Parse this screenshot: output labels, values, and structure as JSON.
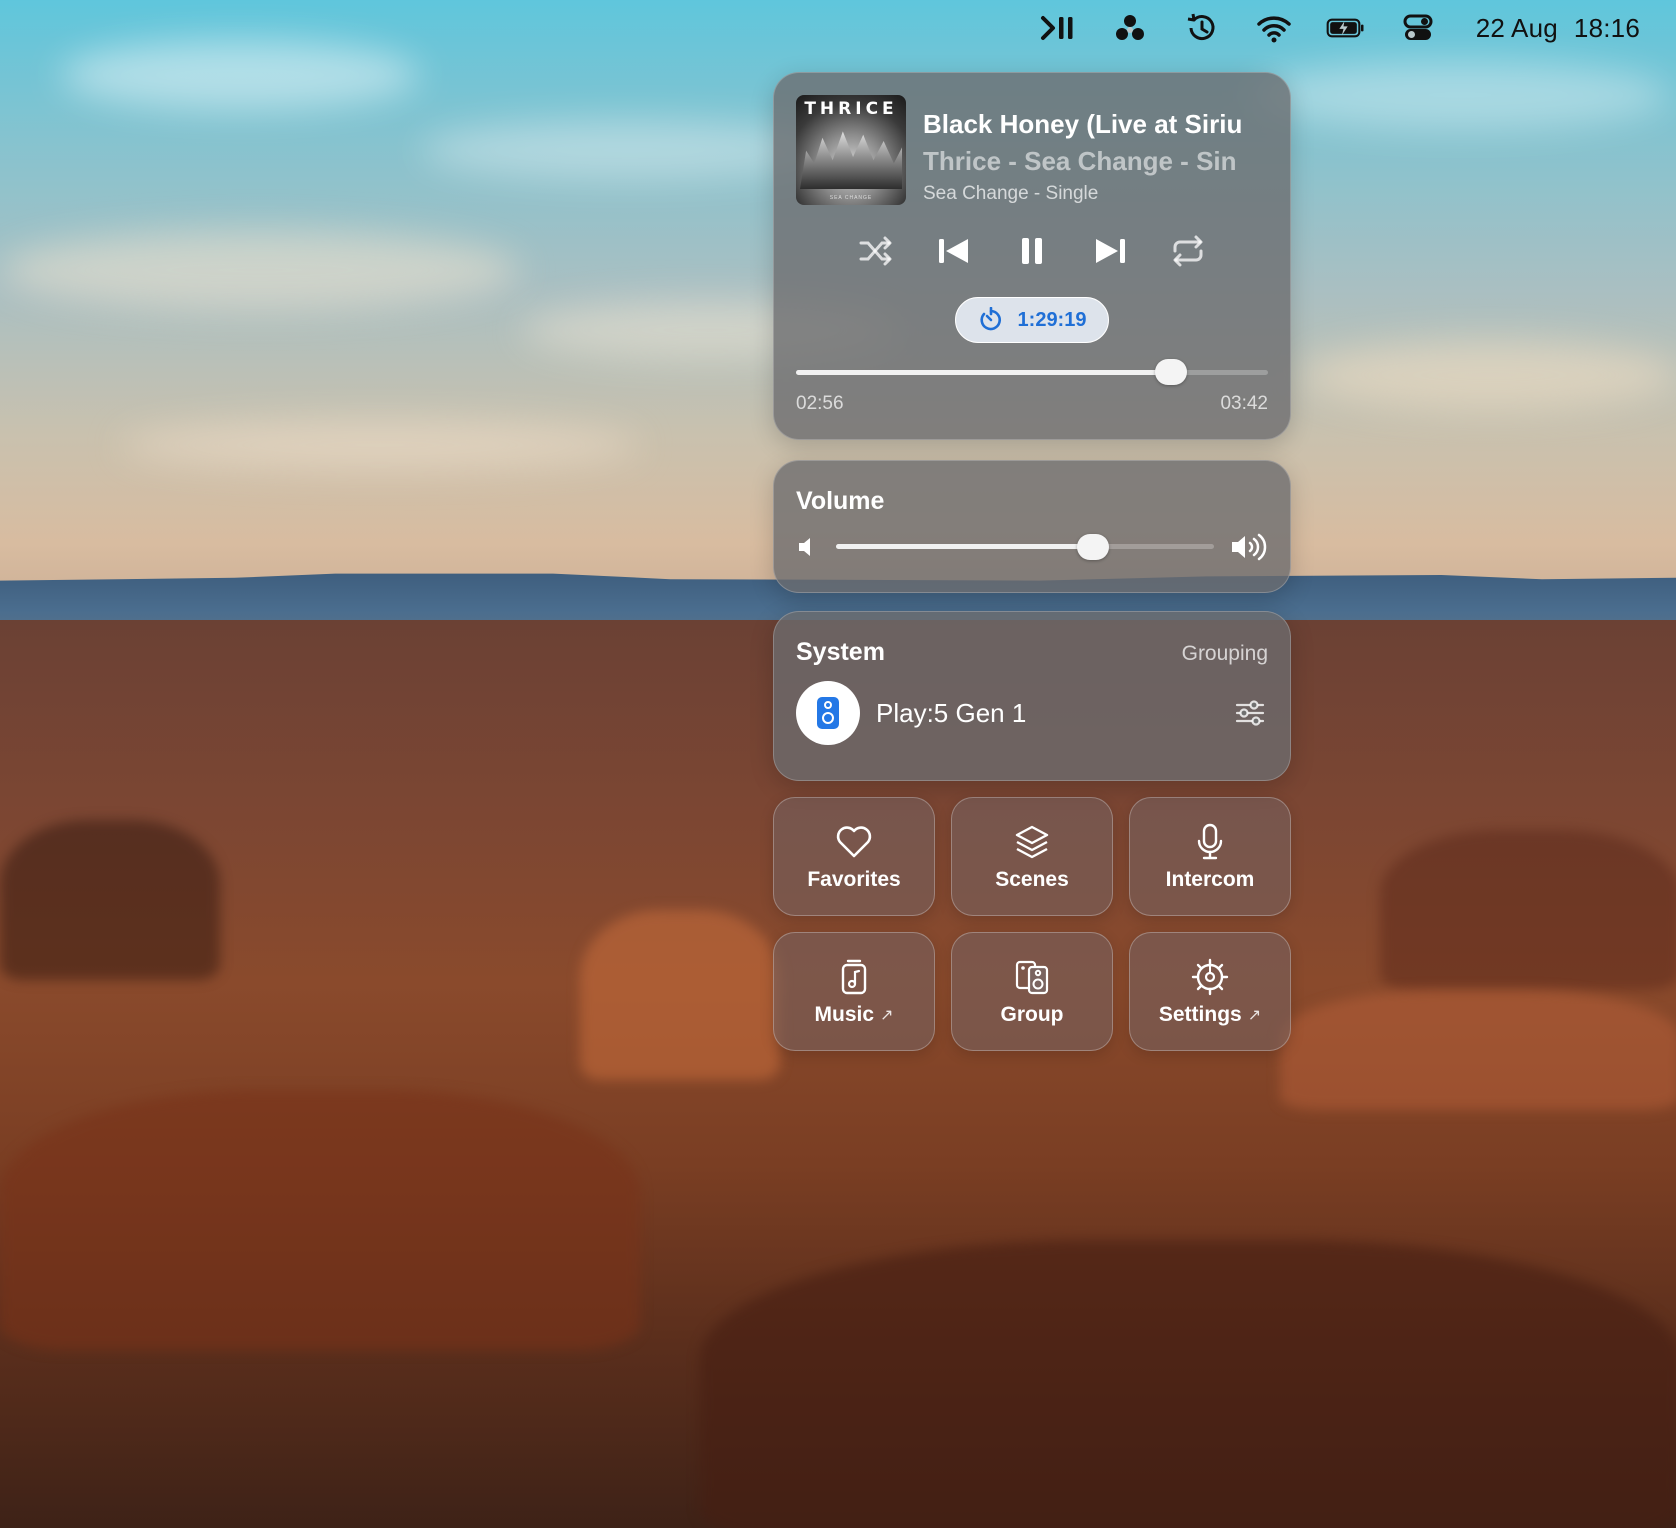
{
  "menubar": {
    "icons": [
      "play-pause-menu-icon",
      "sonos-triangle-icon",
      "time-machine-icon",
      "wifi-icon",
      "battery-charging-icon",
      "control-center-icon"
    ],
    "date": "22 Aug",
    "time": "18:16"
  },
  "now_playing": {
    "artwork_title": "THRICE",
    "artwork_subtitle": "SEA CHANGE",
    "title": "Black Honey (Live at Siriu",
    "artist_line": "Thrice - Sea Change - Sin",
    "album": "Sea Change - Single",
    "controls": [
      "shuffle-icon",
      "previous-icon",
      "pause-icon",
      "next-icon",
      "repeat-icon"
    ],
    "sleep_timer": "1:29:19",
    "elapsed": "02:56",
    "duration": "03:42",
    "progress_fraction": 0.794
  },
  "volume": {
    "title": "Volume",
    "level_fraction": 0.68
  },
  "system": {
    "title": "System",
    "grouping_label": "Grouping",
    "device_name": "Play:5 Gen 1"
  },
  "tiles": [
    {
      "label": "Favorites",
      "icon": "heart-icon",
      "external": false
    },
    {
      "label": "Scenes",
      "icon": "layers-icon",
      "external": false
    },
    {
      "label": "Intercom",
      "icon": "microphone-icon",
      "external": false
    },
    {
      "label": "Music",
      "icon": "music-app-icon",
      "external": true
    },
    {
      "label": "Group",
      "icon": "group-speakers-icon",
      "external": false
    },
    {
      "label": "Settings",
      "icon": "gear-icon",
      "external": true
    }
  ],
  "external_glyph": "↗",
  "colors": {
    "accent": "#1f6fd6",
    "timer_bg": "#dde3eb",
    "device_blue": "#2478e6"
  }
}
